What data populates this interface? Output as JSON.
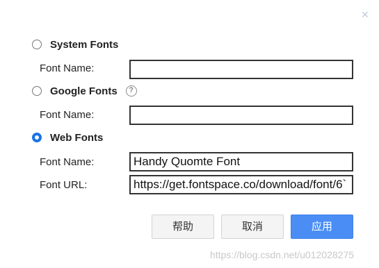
{
  "dialog": {
    "close_symbol": "×"
  },
  "options": {
    "system_fonts": {
      "label": "System Fonts",
      "checked": false
    },
    "google_fonts": {
      "label": "Google Fonts",
      "checked": false,
      "help_symbol": "?"
    },
    "web_fonts": {
      "label": "Web Fonts",
      "checked": true
    }
  },
  "fields": {
    "system_font_name": {
      "label": "Font Name:",
      "value": ""
    },
    "google_font_name": {
      "label": "Font Name:",
      "value": ""
    },
    "web_font_name": {
      "label": "Font Name:",
      "value": "Handy Quomte Font"
    },
    "web_font_url": {
      "label": "Font URL:",
      "value": "https://get.fontspace.co/download/font/6`"
    }
  },
  "buttons": {
    "help_label": "帮助",
    "cancel_label": "取消",
    "apply_label": "应用"
  },
  "watermark": "https://blog.csdn.net/u012028275",
  "colors": {
    "primary": "#4a8ef5",
    "radio_checked": "#1a73e8",
    "close_icon": "#c0c8d4"
  }
}
